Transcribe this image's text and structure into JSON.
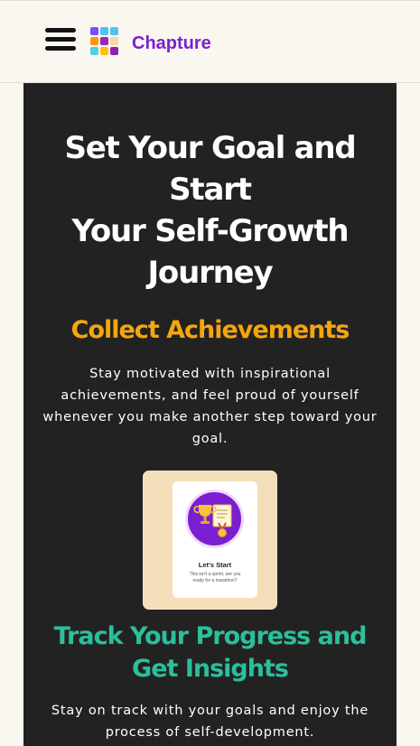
{
  "header": {
    "brand": "Chapture",
    "logo_colors": [
      "#7c4dff",
      "#4fc3f7",
      "#4fc3f7",
      "#ff9800",
      "#9c27b0",
      "#f8d7a8",
      "#4dd0e1",
      "#ffc107",
      "#8e24aa"
    ]
  },
  "hero": {
    "title_lines": [
      "Set Your Goal and",
      "Start",
      "Your Self-Growth",
      "Journey"
    ]
  },
  "achievements": {
    "heading": "Collect Achievements",
    "body": "Stay motivated with inspirational achievements, and feel proud of yourself whenever you make another step toward your goal.",
    "card": {
      "title": "Let's Start",
      "subtitle": "This isn't a sprint, are you ready for a marathon?"
    }
  },
  "progress": {
    "heading_lines": [
      "Track Your Progress and",
      "Get Insights"
    ],
    "body": "Stay on track with your goals and enjoy the process of self-development."
  },
  "colors": {
    "accent_purple": "#7b1fd1",
    "heading_orange": "#f5a50d",
    "heading_teal": "#2bbf9a",
    "panel_bg": "#222222",
    "page_bg": "#faf6f0"
  }
}
